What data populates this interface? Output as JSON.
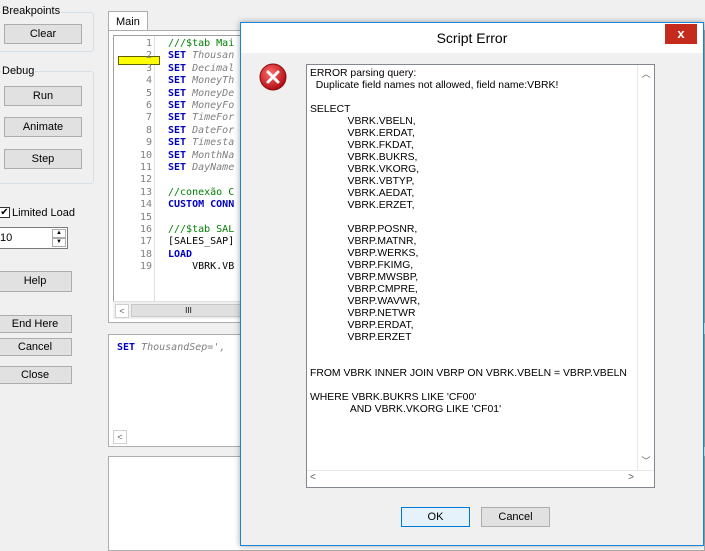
{
  "left_panel": {
    "breakpoints_label": "Breakpoints",
    "clear_label": "Clear",
    "debug_label": "Debug",
    "run_label": "Run",
    "animate_label": "Animate",
    "step_label": "Step",
    "limited_load_label": "Limited Load",
    "limited_load_checked": true,
    "limited_load_value": "10",
    "help_label": "Help",
    "end_here_label": "End Here",
    "cancel_label": "Cancel",
    "close_label": "Close"
  },
  "editor": {
    "tab_label": "Main",
    "lines": [
      {
        "n": "1",
        "text": "///$tab Mai",
        "kind": "cmt"
      },
      {
        "n": "2",
        "kw": "SET",
        "text": " Thousan",
        "kind": "var"
      },
      {
        "n": "3",
        "kw": "SET",
        "text": " Decimal",
        "kind": "var"
      },
      {
        "n": "4",
        "kw": "SET",
        "text": " MoneyTh",
        "kind": "var"
      },
      {
        "n": "5",
        "kw": "SET",
        "text": " MoneyDe",
        "kind": "var"
      },
      {
        "n": "6",
        "kw": "SET",
        "text": " MoneyFo",
        "kind": "var"
      },
      {
        "n": "7",
        "kw": "SET",
        "text": " TimeFor",
        "kind": "var"
      },
      {
        "n": "8",
        "kw": "SET",
        "text": " DateFor",
        "kind": "var"
      },
      {
        "n": "9",
        "kw": "SET",
        "text": " Timesta",
        "kind": "var"
      },
      {
        "n": "10",
        "kw": "SET",
        "text": " MonthNa",
        "kind": "var"
      },
      {
        "n": "11",
        "kw": "SET",
        "text": " DayName",
        "kind": "var"
      },
      {
        "n": "12",
        "text": "",
        "kind": "plain"
      },
      {
        "n": "13",
        "text": "//conexão C",
        "kind": "cmt"
      },
      {
        "n": "14",
        "kw": "CUSTOM",
        "text": " CONN",
        "kind": "kwtail"
      },
      {
        "n": "15",
        "text": "",
        "kind": "plain"
      },
      {
        "n": "16",
        "text": "///$tab SAL",
        "kind": "cmt"
      },
      {
        "n": "17",
        "text": "[SALES_SAP]",
        "kind": "plain"
      },
      {
        "n": "18",
        "kw": "LOAD",
        "text": "",
        "kind": "plain"
      },
      {
        "n": "19",
        "text": "    VBRK.VB",
        "kind": "plain"
      }
    ],
    "scroll_thumb": "III",
    "bottom_pane_text_kw": "SET",
    "bottom_pane_text": " ThousandSep=',"
  },
  "dialog": {
    "title": "Script Error",
    "close_glyph": "x",
    "message": "ERROR parsing query:\n  Duplicate field names not allowed, field name:VBRK!\n\nSELECT\n             VBRK.VBELN,\n             VBRK.ERDAT,\n             VBRK.FKDAT,\n             VBRK.BUKRS,\n             VBRK.VKORG,\n             VBRK.VBTYP,\n             VBRK.AEDAT,\n             VBRK.ERZET,\n\n             VBRP.POSNR,\n             VBRP.MATNR,\n             VBRP.WERKS,\n             VBRP.FKIMG,\n             VBRP.MWSBP,\n             VBRP.CMPRE,\n             VBRP.WAVWR,\n             VBRP.NETWR\n             VBRP.ERDAT,\n             VBRP.ERZET\n\n\nFROM VBRK INNER JOIN VBRP ON VBRK.VBELN = VBRP.VBELN\n\nWHERE VBRK.BUKRS LIKE 'CF00'\n              AND VBRK.VKORG LIKE 'CF01'",
    "ok_label": "OK",
    "cancel_label": "Cancel"
  },
  "colors": {
    "accent": "#1883d7",
    "error_icon": "#c7161a",
    "keyword": "#0000c0",
    "comment": "#008000",
    "breakpoint": "#ffff00"
  }
}
